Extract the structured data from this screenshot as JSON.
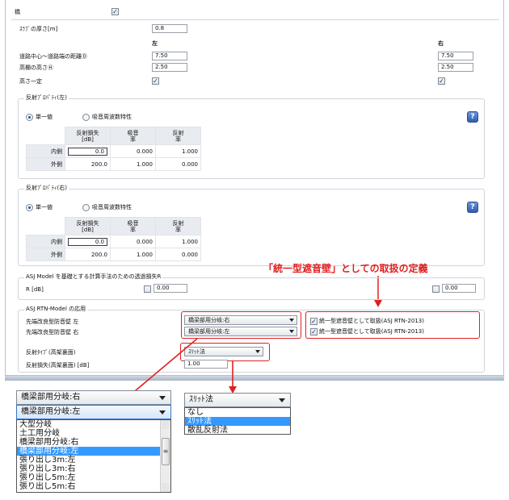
{
  "bridge": {
    "label": "橋",
    "checked": "✓"
  },
  "slab": {
    "label": "ｽﾗﾌﾞの厚さ[m]",
    "value": "0.8"
  },
  "columns": {
    "left": "左",
    "right": "右"
  },
  "distance": {
    "label": "道路中心～道路端の距離Ⓓ",
    "left": "7.50",
    "right": "7.50"
  },
  "rail_height": {
    "label": "高欄の高さⒽ",
    "left": "2.50",
    "right": "2.50"
  },
  "height_const": {
    "label": "高さ一定",
    "left_checked": "✓",
    "right_checked": "✓"
  },
  "refl_left": {
    "title": "反射ﾌﾟﾛﾊﾟﾃｨ(左)",
    "radio_single": "単一値",
    "radio_freq": "吸音周波数特性",
    "headers": [
      "反射損失\n[dB]",
      "吸音\n率",
      "反射\n率"
    ],
    "rows": [
      {
        "label": "内側",
        "loss": "0.0",
        "absorb": "0.000",
        "reflect": "1.000"
      },
      {
        "label": "外側",
        "loss": "200.0",
        "absorb": "1.000",
        "reflect": "0.000"
      }
    ]
  },
  "refl_right": {
    "title": "反射ﾌﾟﾛﾊﾟﾃｨ(右)",
    "radio_single": "単一値",
    "radio_freq": "吸音周波数特性",
    "headers": [
      "反射損失\n[dB]",
      "吸音\n率",
      "反射\n率"
    ],
    "rows": [
      {
        "label": "内側",
        "loss": "0.0",
        "absorb": "0.000",
        "reflect": "1.000"
      },
      {
        "label": "外側",
        "loss": "200.0",
        "absorb": "1.000",
        "reflect": "0.000"
      }
    ]
  },
  "annotation": {
    "text": "「統一型遮音壁」としての取扱の定義"
  },
  "asj": {
    "title": "ASJ Model を基礎とする計算手法のための透過損失R",
    "r_label": "R [dB]",
    "left_value": "0.00",
    "right_value": "0.00"
  },
  "rtn": {
    "title": "ASJ RTN-Model の応用",
    "left_label": "先端改良型防音壁  左",
    "right_label": "先端改良型防音壁  右",
    "left_select": "橋梁部用分岐:右",
    "right_select": "橋梁部用分岐:左",
    "unified_left": "統一型遮音壁として取扱(ASJ RTN-2013)",
    "unified_right": "統一型遮音壁として取扱(ASJ RTN-2013)",
    "refl_type_label": "反射ﾀｲﾌﾟ(高架裏面)",
    "refl_type_value": "ｽﾘｯﾄ法",
    "refl_loss_label": "反射損失(高架裏面) [dB]",
    "refl_loss_value": "1.00"
  },
  "zoom_left": {
    "closed_value": "橋梁部用分岐:右",
    "open_value": "橋梁部用分岐:左",
    "options": [
      "大型分岐",
      "土工用分岐",
      "橋梁部用分岐:右",
      "橋梁部用分岐:左",
      "張り出し3m:左",
      "張り出し3m:右",
      "張り出し5m:左",
      "張り出し5m:右"
    ],
    "highlighted": "橋梁部用分岐:左",
    "scroll_mark": "≡"
  },
  "zoom_right": {
    "closed_value": "ｽﾘｯﾄ法",
    "options": [
      "なし",
      "ｽﾘｯﾄ法",
      "散乱反射法"
    ],
    "highlighted": "ｽﾘｯﾄ法"
  },
  "colors": {
    "annotation_red": "#e02020",
    "highlight": "#3399ff",
    "help_blue": "#2e5db3"
  }
}
